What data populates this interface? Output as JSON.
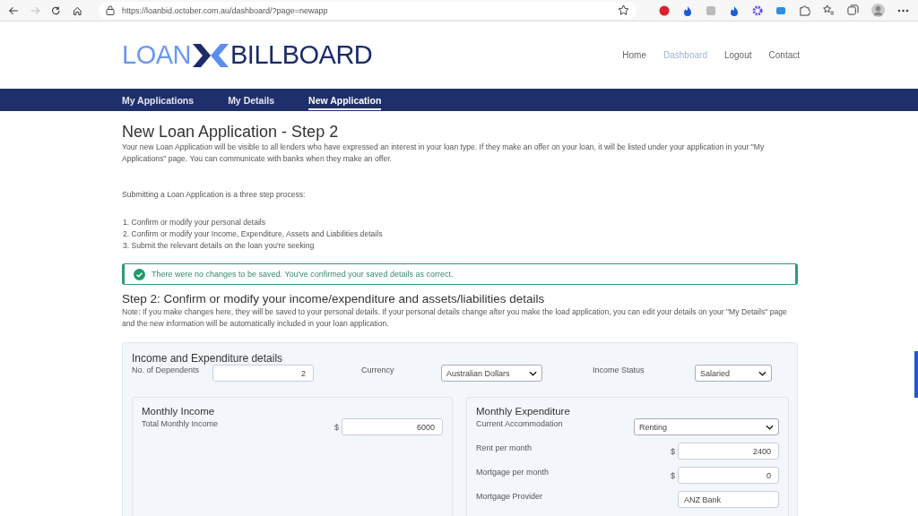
{
  "browser": {
    "url": "https://loanbid.october.com.au/dashboard/?page=newapp"
  },
  "header": {
    "logo": {
      "left": "LOAN",
      "right": "BILLBOARD"
    },
    "nav": [
      {
        "label": "Home",
        "selected": false
      },
      {
        "label": "Dashboard",
        "selected": true
      },
      {
        "label": "Logout",
        "selected": false
      },
      {
        "label": "Contact",
        "selected": false
      }
    ]
  },
  "tabs": [
    {
      "label": "My Applications",
      "selected": false
    },
    {
      "label": "My Details",
      "selected": false
    },
    {
      "label": "New Application",
      "selected": true
    }
  ],
  "title": "New Loan Application - Step 2",
  "intro": "Your new Loan Application will be visible to all lenders who have expressed an interest in your loan type. If they make an offer on your loan, it will be listed under your application in your \"My Applications\" page. You can communicate with banks when they make an offer.",
  "process_intro": "Submitting a Loan Application is a three step process:",
  "steps": [
    "1. Confirm or modify your personal details",
    "2. Confirm or modify your Income, Expenditure, Assets and Liabilities details",
    "3. Submit the relevant details on the loan you're seeking"
  ],
  "alert": {
    "text": "There were no changes to be saved. You've confirmed your saved details as correct."
  },
  "step2": {
    "heading": "Step 2: Confirm or modify your income/expenditure and assets/liabilities details",
    "note": "Note: If you make changes here, they will be saved to your personal details. If your personal details change after you make the load application, you can edit your details on your \"My Details\" page and the new information will be automatically included in your loan application."
  },
  "panel": {
    "title": "Income and Expenditure details",
    "fields": [
      {
        "label": "No. of Dependents",
        "kind": "number",
        "value": "2"
      },
      {
        "label": "Currency",
        "kind": "select",
        "value": "Australian Dollars"
      },
      {
        "label": "Income Status",
        "kind": "select",
        "value": "Salaried"
      }
    ]
  },
  "income": {
    "title": "Monthly Income",
    "rows": [
      {
        "label": "Total Monthly Income",
        "kind": "money",
        "value": "6000"
      }
    ]
  },
  "expenditure": {
    "title": "Monthly Expenditure",
    "rows": [
      {
        "label": "Current Accommodation",
        "kind": "select",
        "value": "Renting"
      },
      {
        "label": "Rent per month",
        "kind": "money",
        "value": "2400"
      },
      {
        "label": "Mortgage per month",
        "kind": "money",
        "value": "0"
      },
      {
        "label": "Mortgage Provider",
        "kind": "text",
        "value": "ANZ Bank"
      }
    ]
  },
  "currency_symbol": "$"
}
